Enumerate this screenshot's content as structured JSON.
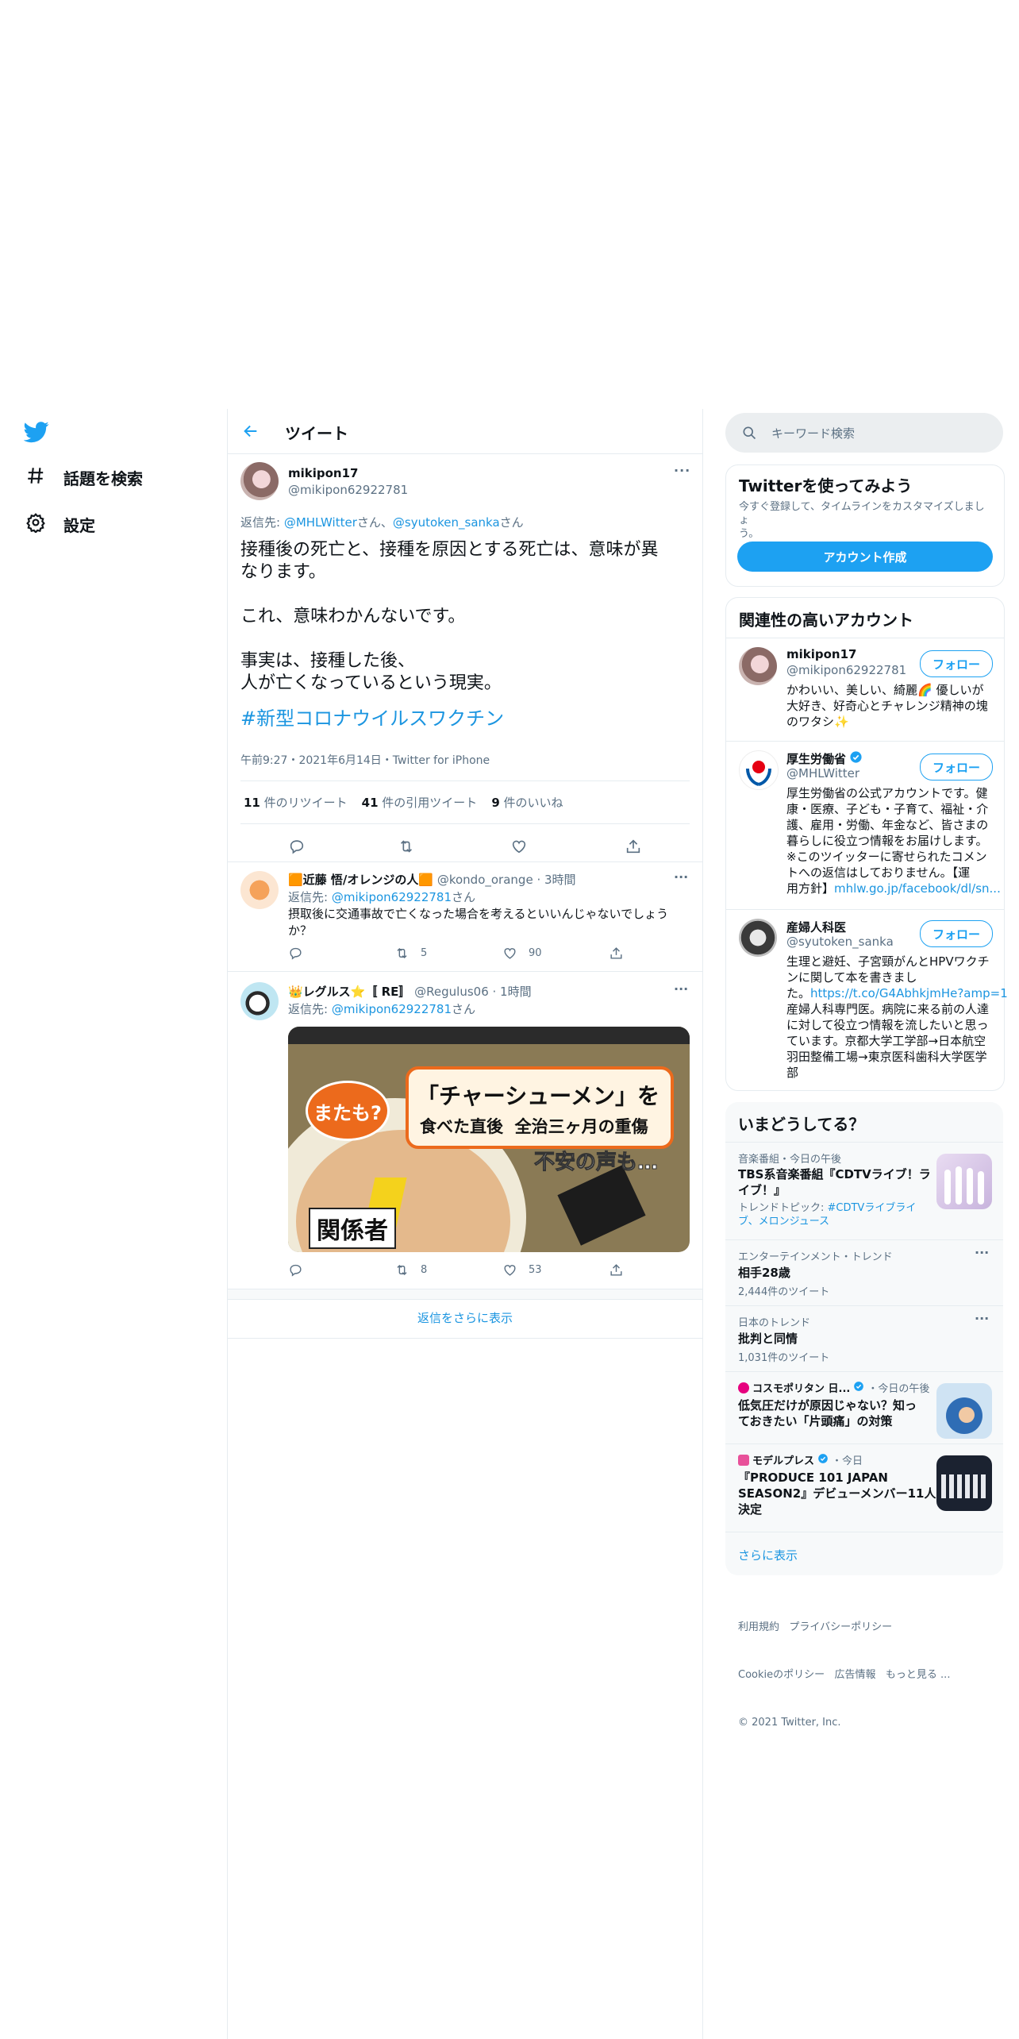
{
  "nav": {
    "explore": "話題を検索",
    "settings": "設定"
  },
  "header": {
    "title": "ツイート"
  },
  "tweet": {
    "display_name": "mikipon17",
    "handle": "@mikipon62922781",
    "reply_prefix": "返信先: ",
    "reply_to_1": "@MHLWitter",
    "reply_sep": "さん、",
    "reply_to_2": "@syutoken_sanka",
    "reply_suffix": "さん",
    "line1": "接種後の死亡と、接種を原因とする死亡は、意味が異",
    "line2": "なります。",
    "line3": "これ、意味わかんないです。",
    "line4": "事実は、接種した後、",
    "line5": "人が亡くなっているという現実。",
    "hashtag": "#新型コロナウイルスワクチン",
    "meta": "午前9:27・2021年6月14日・Twitter for iPhone",
    "retweets_count": "11",
    "retweets_label": " 件のリツイート",
    "quotes_count": "41",
    "quotes_label": " 件の引用ツイート",
    "likes_count": "9",
    "likes_label": " 件のいいね"
  },
  "replies": [
    {
      "name": "🟧近藤 悟/オレンジの人🟧",
      "handle_time": "@kondo_orange · 3時間",
      "reply_prefix": "返信先: ",
      "reply_to": "@mikipon62922781",
      "reply_suffix": "さん",
      "text_line1": "摂取後に交通事故で亡くなった場合を考えるといいんじゃないでしょう",
      "text_line2": "か？",
      "retweets": "5",
      "likes": "90"
    },
    {
      "name": "👑レグルス⭐️〚 RE〛",
      "handle_time": "@Regulus06 · 1時間",
      "reply_prefix": "返信先: ",
      "reply_to": "@mikipon62922781",
      "reply_suffix": "さん",
      "image_badge": "またも?",
      "image_headline": "「チャーシューメン」を",
      "image_headline_suffix": "を",
      "image_sub": "食べた直後  全治三ヶ月の重傷",
      "image_voice": "不安の声も…",
      "image_caption": "関係者",
      "retweets": "8",
      "likes": "53"
    }
  ],
  "show_more_replies": "返信をさらに表示",
  "search": {
    "placeholder": "キーワード検索"
  },
  "signup": {
    "title": "Twitterを使ってみよう",
    "desc_line1": "今すぐ登録して、タイムラインをカスタマイズしましょ",
    "desc_line2": "う。",
    "button": "アカウント作成"
  },
  "related": {
    "title": "関連性の高いアカウント",
    "follow_label": "フォロー",
    "accounts": [
      {
        "name": "mikipon17",
        "handle": "@mikipon62922781",
        "bio": [
          "かわいい、美しい、綺麗🌈 優しいが",
          "大好き、好奇心とチャレンジ精神の塊",
          "のワタシ✨"
        ]
      },
      {
        "name": "厚生労働省",
        "handle": "@MHLWitter",
        "bio": [
          "厚生労働省の公式アカウントです。健",
          "康・医療、子ども・子育て、福祉・介",
          "護、雇用・労働、年金など、皆さまの",
          "暮らしに役立つ情報をお届けします。",
          "※このツイッターに寄せられたコメン",
          "トへの返信はしておりません。【運"
        ],
        "bio_last_prefix": "用方針】",
        "bio_last_link": "mhlw.go.jp/facebook/dl/sn..."
      },
      {
        "name": "産婦人科医",
        "handle": "@syutoken_sanka",
        "bio_pre": [
          "生理と避妊、子宮頸がんとHPVワクチ",
          "ンに関して本を書きまし"
        ],
        "bio_link_prefix": "た。",
        "bio_link": "https://t.co/G4AbhkjmHe?amp=1",
        "bio_post": [
          "産婦人科専門医。病院に来る前の人達",
          "に対して役立つ情報を流したいと思っ",
          "ています。京都大学工学部→日本航空",
          "羽田整備工場→東京医科歯科大学医学",
          "部"
        ]
      }
    ]
  },
  "trends": {
    "title": "いまどうしてる？",
    "items": [
      {
        "meta": "音楽番組・今日の午後",
        "title_line1": "TBS系音楽番組『CDTVライブ！ラ",
        "title_line2": "イブ！』",
        "sub_prefix": "トレンドトピック: ",
        "sub_link_line1": "#CDTVライブライ",
        "sub_link_line2": "ブ、メロンジュース"
      },
      {
        "meta": "エンターテインメント・トレンド",
        "title": "相手28歳",
        "count": "2,444件のツイート"
      },
      {
        "meta": "日本のトレンド",
        "title": "批判と同情",
        "count": "1,031件のツイート"
      },
      {
        "source": "コスモポリタン 日...",
        "meta_suffix": "・今日の午後",
        "title_line1": "低気圧だけが原因じゃない？知っ",
        "title_line2": "ておきたい「片頭痛」の対策"
      },
      {
        "source": "モデルプレス",
        "meta_suffix": "・今日",
        "title_line1": "『PRODUCE 101 JAPAN",
        "title_line2": "SEASON2』デビューメンバー11人",
        "title_line3": "決定"
      }
    ],
    "show_more": "さらに表示"
  },
  "footer": {
    "line1": "利用規約   プライバシーポリシー",
    "line2": "Cookieのポリシー   広告情報   もっと見る ...",
    "line3": "© 2021 Twitter, Inc."
  },
  "colors": {
    "accent": "#1da1f2",
    "link": "#1b95e0",
    "muted": "#5b7083"
  }
}
